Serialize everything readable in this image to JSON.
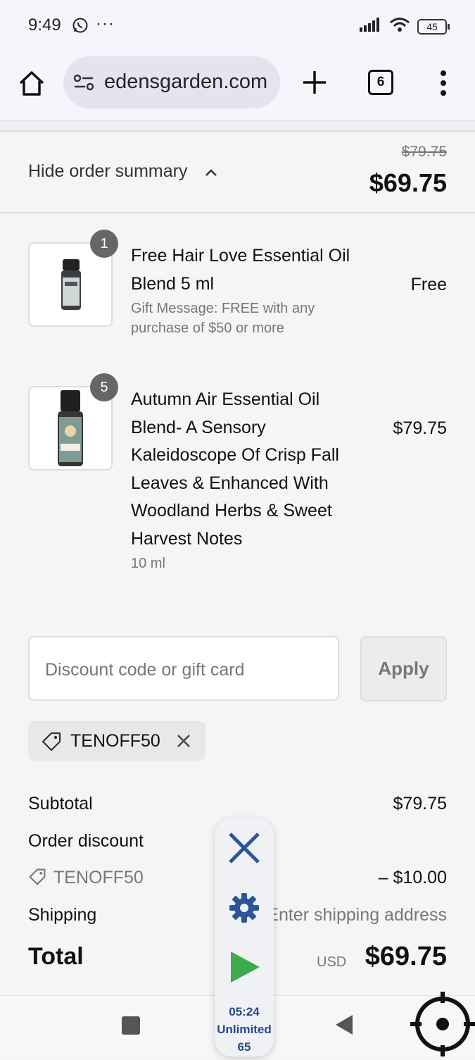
{
  "status_bar": {
    "time": "9:49",
    "dots": "···",
    "battery": "45"
  },
  "browser": {
    "url": "edensgarden.com",
    "tab_count": "6"
  },
  "summary": {
    "toggle_label": "Hide order summary",
    "original_price": "$79.75",
    "total": "$69.75"
  },
  "items": [
    {
      "qty": "1",
      "name": "Free Hair Love Essential Oil Blend 5 ml",
      "detail": "Gift Message: FREE with any purchase of $50 or more",
      "price": "Free"
    },
    {
      "qty": "5",
      "name": "Autumn Air Essential Oil Blend- A Sensory Kaleidoscope Of Crisp Fall Leaves & Enhanced With Woodland Herbs & Sweet Harvest Notes",
      "detail": "10 ml",
      "price": "$79.75"
    }
  ],
  "discount": {
    "placeholder": "Discount code or gift card",
    "apply_label": "Apply",
    "applied_code": "TENOFF50"
  },
  "totals": {
    "subtotal_label": "Subtotal",
    "subtotal_value": "$79.75",
    "order_discount_label": "Order discount",
    "discount_code": "TENOFF50",
    "discount_value": "– $10.00",
    "shipping_label": "Shipping",
    "shipping_value": "Enter shipping address",
    "total_label": "Total",
    "currency": "USD",
    "total_value": "$69.75"
  },
  "overlay": {
    "timer": "05:24",
    "plan": "Unlimited",
    "count": "65"
  },
  "colors": {
    "accent_blue": "#2a5599",
    "play_green": "#3daa4b",
    "badge_gray": "#666666"
  }
}
